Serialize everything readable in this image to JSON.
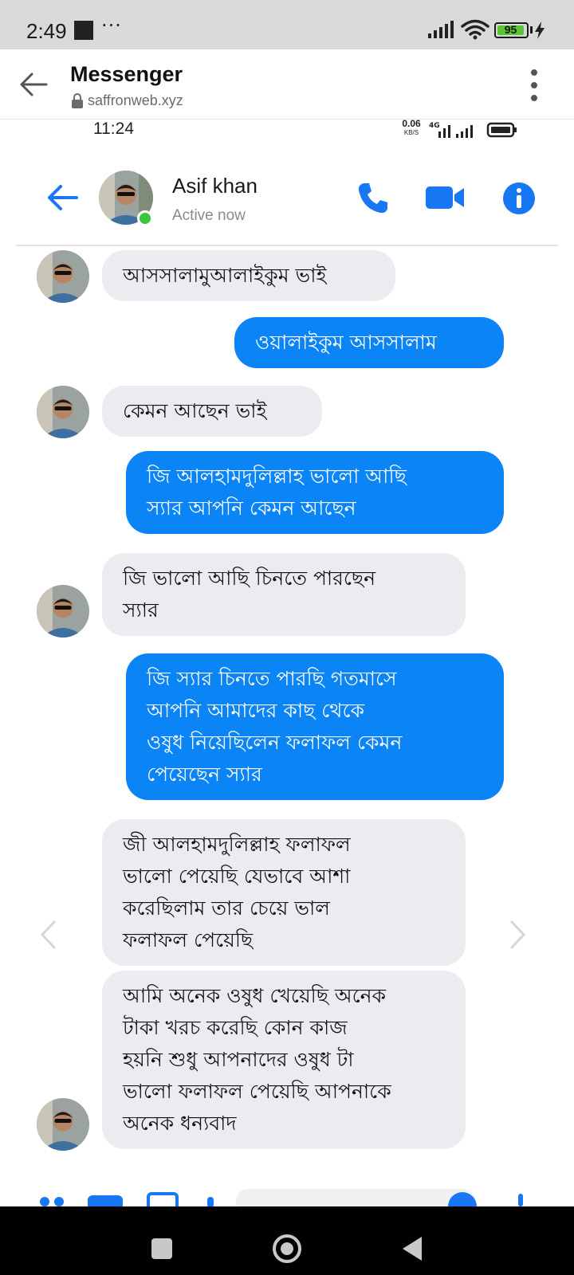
{
  "status_bar": {
    "time": "2:49",
    "more": "···",
    "battery": "95"
  },
  "browser": {
    "title": "Messenger",
    "url": "saffronweb.xyz"
  },
  "inner_status": {
    "time": "11:24",
    "speed_value": "0.06",
    "speed_unit": "KB/S",
    "network": "4G"
  },
  "chat_header": {
    "contact_name": "Asif khan",
    "contact_status": "Active now"
  },
  "messages": [
    {
      "from": "them",
      "text": "আসসালামুআলাইকুম ভাই"
    },
    {
      "from": "me",
      "text": "ওয়ালাইকুম আসসালাম"
    },
    {
      "from": "them",
      "text": "কেমন আছেন ভাই"
    },
    {
      "from": "me",
      "text": "জি আলহামদুলিল্লাহ ভালো আছি\nস্যার আপনি কেমন আছেন"
    },
    {
      "from": "them",
      "text": "জি ভালো আছি চিনতে পারছেন\nস্যার"
    },
    {
      "from": "me",
      "text": "জি স্যার চিনতে পারছি গতমাসে\nআপনি আমাদের কাছ থেকে\nওষুধ নিয়েছিলেন ফলাফল কেমন\nপেয়েছেন স্যার"
    },
    {
      "from": "them",
      "text": "জী আলহামদুলিল্লাহ ফলাফল\nভালো পেয়েছি যেভাবে আশা\nকরেছিলাম তার চেয়ে ভাল\nফলাফল পেয়েছি"
    },
    {
      "from": "them",
      "text": "আমি অনেক ওষুধ খেয়েছি অনেক\nটাকা খরচ করেছি  কোন কাজ\nহয়নি শুধু আপনাদের ওষুধ টা\nভালো ফলাফল পেয়েছি আপনাকে\nঅনেক ধন্যবাদ"
    }
  ],
  "colors": {
    "messenger_blue": "#0b84f5",
    "incoming_bubble": "#ececf0",
    "online_green": "#39c53d",
    "battery_green": "#5cc534"
  },
  "icons": [
    "back-arrow-icon",
    "lock-icon",
    "overflow-menu-icon",
    "phone-icon",
    "video-camera-icon",
    "info-icon",
    "chevron-left-icon",
    "chevron-right-icon"
  ]
}
